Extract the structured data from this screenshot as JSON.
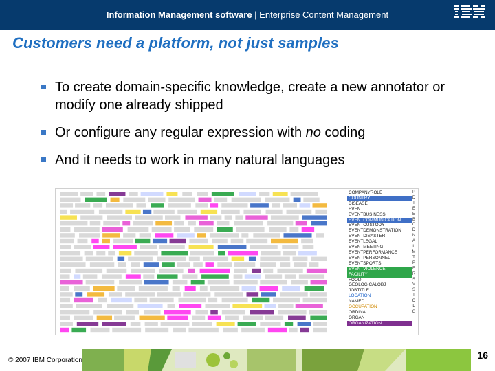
{
  "header": {
    "title_bold": "Information Management software",
    "separator": " | ",
    "title_rest": "Enterprise Content Management",
    "logo": "IBM",
    "bar_color": "#063a6d"
  },
  "slide": {
    "heading": "Customers need a platform, not just samples",
    "bullets": [
      {
        "text": "To create domain-specific knowledge, create a new annotator or modify one already shipped"
      },
      {
        "pre": "Or configure any regular expression with ",
        "em": "no",
        "post": " coding"
      },
      {
        "text": "And it needs to work in many natural languages"
      }
    ],
    "accent_color": "#1f6fc1"
  },
  "figure": {
    "row_numbers": [
      "1",
      "2",
      "3",
      "4",
      "5",
      "6"
    ],
    "categories": [
      "COMPANYROLE",
      "COUNTRY",
      "DISEASE",
      "EVENT",
      "EVENTBUSINESS",
      "EVENTCOMMUNICATION",
      "EVENTCUSTODY",
      "EVENTDEMONSTRATION",
      "EVENTDISASTER",
      "EVENTLEGAL",
      "EVENTMEETING",
      "EVENTPERFORMANCE",
      "EVENTPERSONNEL",
      "EVENTSPORTS",
      "EVENTVIOLENCE",
      "FACILITY",
      "FOOD",
      "GEOLOGICALOBJ",
      "JOBTITLE",
      "LOCATION",
      "NAMED",
      "OCCUPATION",
      "ORDINAL",
      "ORGAN",
      "ORGANIZATION"
    ],
    "side_letters": [
      "P",
      "D",
      "I",
      "E",
      "E",
      "B",
      "O",
      "D",
      "N",
      "A",
      "L",
      "M",
      "T",
      "P",
      "E",
      "R",
      "S",
      "V",
      "S",
      "I",
      "O",
      "L",
      "G"
    ]
  },
  "footer": {
    "copyright": "© 2007 IBM Corporation",
    "page_number": "16"
  }
}
